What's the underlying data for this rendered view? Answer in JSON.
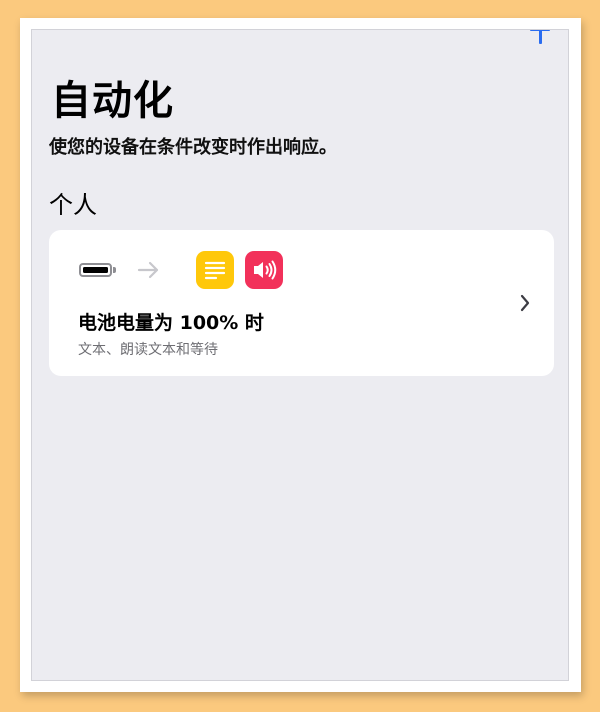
{
  "header": {
    "title": "自动化",
    "subtitle": "使您的设备在条件改变时作出响应。",
    "add_icon": "plus-icon"
  },
  "section": {
    "label": "个人"
  },
  "automation": {
    "trigger_icon": "battery-icon",
    "arrow_icon": "arrow-right-icon",
    "action_icons": [
      "text-icon",
      "speaker-icon"
    ],
    "title": "电池电量为 100% 时",
    "description": "文本、朗读文本和等待",
    "chevron_icon": "chevron-right-icon"
  },
  "colors": {
    "accent": "#2a6cf0",
    "background": "#ececf1",
    "card": "#ffffff",
    "text_icon_bg": "#ffc80a",
    "speak_icon_bg": "#f2315a",
    "secondary_text": "#6e6e73",
    "frame_bg": "#fbc97e"
  }
}
